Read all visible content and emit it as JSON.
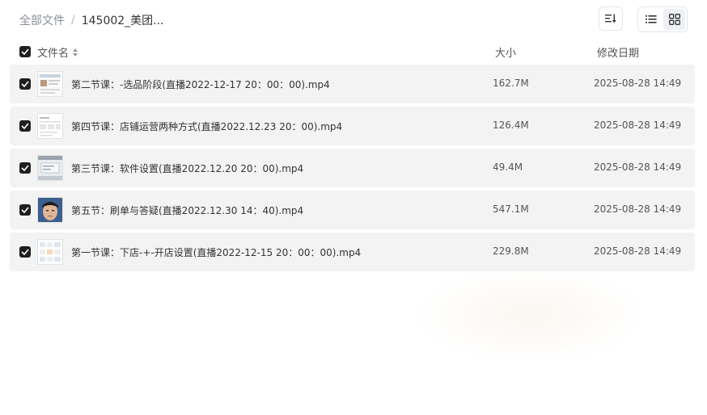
{
  "breadcrumb": {
    "root": "全部文件",
    "separator": "/",
    "current": "145002_美团..."
  },
  "toolbar": {
    "sort_icon": "sort-icon",
    "list_view_icon": "list-view-icon",
    "grid_view_icon": "grid-view-icon"
  },
  "columns": {
    "name": "文件名",
    "size": "大小",
    "modified": "修改日期"
  },
  "files": [
    {
      "name": "第二节课：-选品阶段(直播2022-12-17 20：00：00).mp4",
      "size": "162.7M",
      "modified": "2025-08-28 14:49",
      "thumb": "slide"
    },
    {
      "name": "第四节课：店铺运营两种方式(直播2022.12.23 20：00).mp4",
      "size": "126.4M",
      "modified": "2025-08-28 14:49",
      "thumb": "doc"
    },
    {
      "name": "第三节课：软件设置(直播2022.12.20 20：00).mp4",
      "size": "49.4M",
      "modified": "2025-08-28 14:49",
      "thumb": "app"
    },
    {
      "name": "第五节：刷单与答疑(直播2022.12.30 14：40).mp4",
      "size": "547.1M",
      "modified": "2025-08-28 14:49",
      "thumb": "face"
    },
    {
      "name": "第一节课：下店-+-开店设置(直播2022-12-15 20：00：00).mp4",
      "size": "229.8M",
      "modified": "2025-08-28 14:49",
      "thumb": "grid"
    }
  ],
  "colors": {
    "row_bg": "#f3f3f4",
    "checkbox": "#1f1f1f",
    "muted_text": "#8a8f99"
  }
}
